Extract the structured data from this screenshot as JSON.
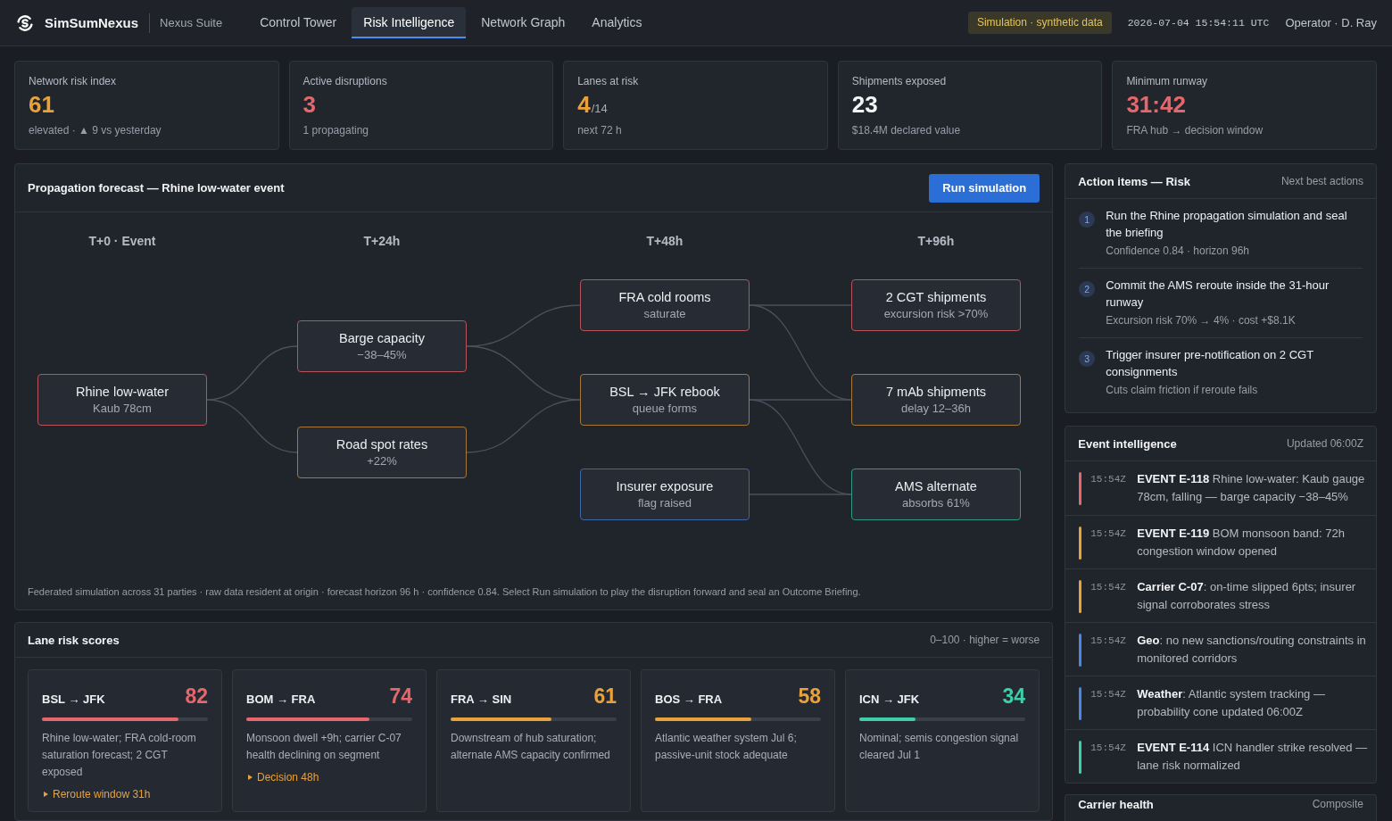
{
  "top_bar": {
    "brand": "SimSumNexus",
    "suite": "Nexus Suite",
    "tabs": [
      {
        "label": "Control Tower",
        "selected": false
      },
      {
        "label": "Risk Intelligence",
        "selected": true
      },
      {
        "label": "Network Graph",
        "selected": false
      },
      {
        "label": "Analytics",
        "selected": false
      }
    ],
    "badge": "Simulation · synthetic data",
    "timestamp": "2026-07-04 15:54:11 UTC",
    "operator": "Operator · D. Ray"
  },
  "kpis": [
    {
      "label": "Network risk index",
      "value": "61",
      "color": "#e9a23b",
      "detail": "elevated · ▲ 9 vs yesterday"
    },
    {
      "label": "Active disruptions",
      "value": "3",
      "color": "#e5676b",
      "detail": "1 propagating"
    },
    {
      "label": "Lanes at risk",
      "value": "4",
      "suffix": "/14",
      "color": "#e9a23b",
      "detail": "next 72 h"
    },
    {
      "label": "Shipments exposed",
      "value": "23",
      "color": "#f3f4f6",
      "detail": "$18.4M declared value"
    },
    {
      "label": "Minimum runway",
      "value": "31:42",
      "color": "#e5676b",
      "detail": "FRA hub → decision window"
    }
  ],
  "propagation_panel": {
    "title": "Propagation forecast — Rhine low-water event",
    "button": "Run simulation",
    "columns": [
      {
        "header": "T+0 · Event",
        "nodes": [
          {
            "title": "Rhine low-water",
            "detail": "Kaub 78cm",
            "color": "#b5545a"
          }
        ]
      },
      {
        "header": "T+24h",
        "nodes": [
          {
            "title": "Barge capacity",
            "detail": "−38–45%",
            "color": "#b5545a"
          },
          {
            "title": "Road spot rates",
            "detail": "+22%",
            "color": "#a8783a"
          }
        ]
      },
      {
        "header": "T+48h",
        "nodes": [
          {
            "title": "FRA cold rooms",
            "detail": "saturate",
            "color": "#b5545a"
          },
          {
            "title": "BSL → JFK rebook",
            "detail": "queue forms",
            "color": "#a8783a"
          },
          {
            "title": "Insurer exposure",
            "detail": "flag raised",
            "color": "#3c68a6"
          }
        ]
      },
      {
        "header": "T+96h",
        "nodes": [
          {
            "title": "2 CGT shipments",
            "detail": "excursion risk >70%",
            "color": "#b5545a"
          },
          {
            "title": "7 mAb shipments",
            "detail": "delay 12–36h",
            "color": "#a8783a"
          },
          {
            "title": "AMS alternate",
            "detail": "absorbs 61%",
            "color": "#2e9a86"
          }
        ]
      }
    ],
    "footnote": "Federated simulation across 31 parties · raw data resident at origin · forecast horizon 96 h · confidence 0.84. Select Run simulation to play the disruption forward and seal an Outcome Briefing."
  },
  "lane_panel": {
    "title": "Lane risk scores",
    "scale_note": "0–100 · higher = worse",
    "lanes": [
      {
        "route": "BSL → JFK",
        "score": "82",
        "color": "#e5676b",
        "level": 0.82,
        "description": "Rhine low-water; FRA cold-room saturation forecast; 2 CGT exposed",
        "action": "Reroute window 31h"
      },
      {
        "route": "BOM → FRA",
        "score": "74",
        "color": "#e5676b",
        "level": 0.74,
        "description": "Monsoon dwell +9h; carrier C-07 health declining on segment",
        "action": "Decision 48h"
      },
      {
        "route": "FRA → SIN",
        "score": "61",
        "color": "#e9a23b",
        "level": 0.61,
        "description": "Downstream of hub saturation; alternate AMS capacity confirmed"
      },
      {
        "route": "BOS → FRA",
        "score": "58",
        "color": "#e9a23b",
        "level": 0.58,
        "description": "Atlantic weather system Jul 6; passive-unit stock adequate"
      },
      {
        "route": "ICN → JFK",
        "score": "34",
        "color": "#3ecfa8",
        "level": 0.34,
        "description": "Nominal; semis congestion signal cleared Jul 1"
      }
    ]
  },
  "action_items": {
    "title": "Action items — Risk",
    "subtitle": "Next best actions",
    "items": [
      {
        "number": "1",
        "text": "Run the Rhine propagation simulation and seal the briefing",
        "detail": "Confidence 0.84 · horizon 96h"
      },
      {
        "number": "2",
        "text": "Commit the AMS reroute inside the 31-hour runway",
        "detail": "Excursion risk 70% → 4% · cost +$8.1K"
      },
      {
        "number": "3",
        "text": "Trigger insurer pre-notification on 2 CGT consignments",
        "detail": "Cuts claim friction if reroute fails"
      }
    ]
  },
  "event_intelligence": {
    "title": "Event intelligence",
    "updated": "Updated 06:00Z",
    "events": [
      {
        "time": "15:54Z",
        "text": "**EVENT E-118** Rhine low-water: Kaub gauge 78cm, falling — barge capacity −38–45%",
        "color": "#e5676b"
      },
      {
        "time": "15:54Z",
        "text": "**EVENT E-119** BOM monsoon band: 72h congestion window opened",
        "color": "#e9a23b"
      },
      {
        "time": "15:54Z",
        "text": "**Carrier C-07**: on-time slipped 6pts; insurer signal corroborates stress",
        "color": "#e9a23b"
      },
      {
        "time": "15:54Z",
        "text": "**Geo**: no new sanctions/routing constraints in monitored corridors",
        "color": "#4a86e8"
      },
      {
        "time": "15:54Z",
        "text": "**Weather**: Atlantic system tracking — probability cone updated 06:00Z",
        "color": "#4a86e8"
      },
      {
        "time": "15:54Z",
        "text": "**EVENT E-114** ICN handler strike resolved — lane risk normalized",
        "color": "#3ecfa8"
      }
    ]
  },
  "carrier_health": {
    "title": "Carrier health",
    "subtitle": "Composite"
  }
}
